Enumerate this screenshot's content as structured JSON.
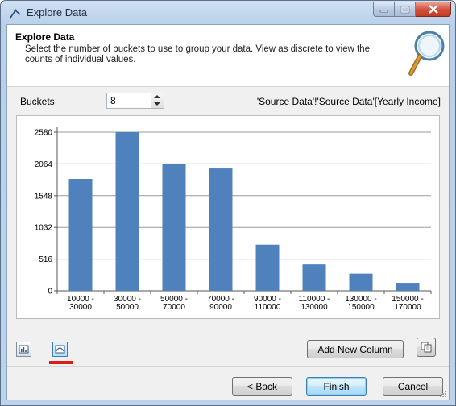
{
  "window": {
    "title": "Explore Data"
  },
  "header": {
    "title": "Explore Data",
    "description": "Select the number of buckets to use to group your data.  View as discrete to view the counts of individual values."
  },
  "controls": {
    "buckets_label": "Buckets",
    "buckets_value": "8",
    "source_label": "'Source Data'!'Source Data'[Yearly Income]"
  },
  "chart_data": {
    "type": "bar",
    "categories": [
      "10000 - 30000",
      "30000 - 50000",
      "50000 - 70000",
      "70000 - 90000",
      "90000 - 110000",
      "110000 - 130000",
      "130000 - 150000",
      "150000 - 170000"
    ],
    "category_lines": [
      [
        "10000 -",
        "30000"
      ],
      [
        "30000 -",
        "50000"
      ],
      [
        "50000 -",
        "70000"
      ],
      [
        "70000 -",
        "90000"
      ],
      [
        "90000 -",
        "110000"
      ],
      [
        "110000 -",
        "130000"
      ],
      [
        "130000 -",
        "150000"
      ],
      [
        "150000 -",
        "170000"
      ]
    ],
    "values": [
      1820,
      2580,
      2060,
      1990,
      750,
      430,
      280,
      130
    ],
    "yticks": [
      0,
      516,
      1032,
      1548,
      2064,
      2580
    ],
    "ylim": [
      0,
      2580
    ],
    "title": "",
    "xlabel": "",
    "ylabel": "",
    "grid": "horizontal",
    "bar_color": "#4f81bd"
  },
  "buttons": {
    "add_column": "Add New Column",
    "back": "< Back",
    "finish": "Finish",
    "cancel": "Cancel"
  },
  "colors": {
    "accent_underline": "#e01a1a",
    "bar": "#4f81bd"
  }
}
